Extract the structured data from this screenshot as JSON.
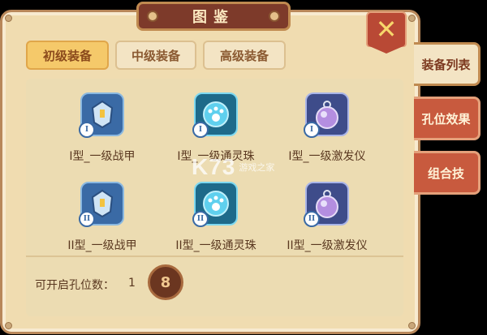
{
  "title": "图鉴",
  "close_icon": "close-x-icon",
  "tabs": [
    {
      "label": "初级装备",
      "active": true
    },
    {
      "label": "中级装备",
      "active": false
    },
    {
      "label": "高级装备",
      "active": false
    }
  ],
  "side_tabs": [
    {
      "label": "装备列表",
      "active": true
    },
    {
      "label": "孔位效果",
      "active": false
    },
    {
      "label": "组合技",
      "active": false
    }
  ],
  "items": [
    {
      "label": "I型_一级战甲",
      "icon": "armor-icon",
      "grade": "I"
    },
    {
      "label": "I型_一级通灵珠",
      "icon": "paw-orb-icon",
      "grade": "I"
    },
    {
      "label": "I型_一级激发仪",
      "icon": "pocket-watch-icon",
      "grade": "I"
    },
    {
      "label": "II型_一级战甲",
      "icon": "armor-icon",
      "grade": "II"
    },
    {
      "label": "II型_一级通灵珠",
      "icon": "paw-orb-icon",
      "grade": "II"
    },
    {
      "label": "II型_一级激发仪",
      "icon": "pocket-watch-icon",
      "grade": "II"
    }
  ],
  "slots": {
    "label": "可开启孔位数：",
    "value": "1",
    "icon": "slot-8-icon",
    "icon_text": "8"
  },
  "watermark": {
    "logo": "K73",
    "sub": "游戏之家"
  },
  "colors": {
    "active_tab": "#f5c96a",
    "side_tab_inactive": "#c85a3e",
    "panel": "#f0dcb0"
  }
}
